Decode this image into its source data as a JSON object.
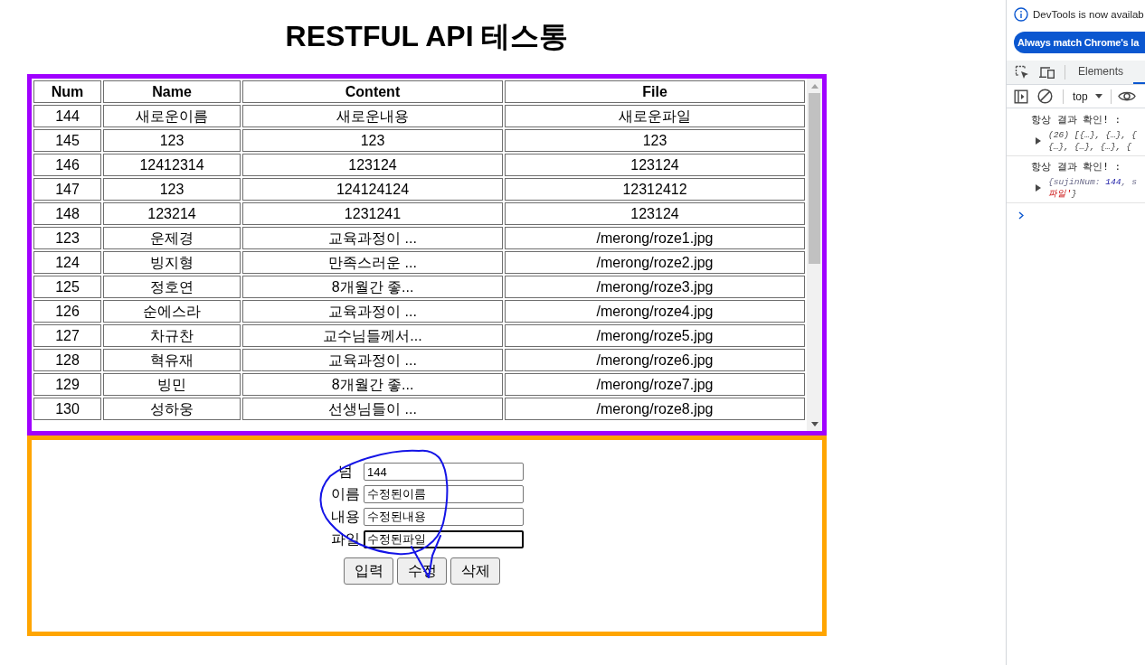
{
  "page": {
    "title": "RESTFUL API 테스통"
  },
  "table": {
    "columns": [
      "Num",
      "Name",
      "Content",
      "File"
    ],
    "rows": [
      [
        "144",
        "새로운이름",
        "새로운내용",
        "새로운파일"
      ],
      [
        "145",
        "123",
        "123",
        "123"
      ],
      [
        "146",
        "12412314",
        "123124",
        "123124"
      ],
      [
        "147",
        "123",
        "124124124",
        "12312412"
      ],
      [
        "148",
        "123214",
        "1231241",
        "123124"
      ],
      [
        "123",
        "운제경",
        "교육과정이 ...",
        "/merong/roze1.jpg"
      ],
      [
        "124",
        "빙지형",
        "만족스러운 ...",
        "/merong/roze2.jpg"
      ],
      [
        "125",
        "정호연",
        "8개월간 좋...",
        "/merong/roze3.jpg"
      ],
      [
        "126",
        "순에스라",
        "교육과정이 ...",
        "/merong/roze4.jpg"
      ],
      [
        "127",
        "차규찬",
        "교수님들께서...",
        "/merong/roze5.jpg"
      ],
      [
        "128",
        "혁유재",
        "교육과정이 ...",
        "/merong/roze6.jpg"
      ],
      [
        "129",
        "빙민",
        "8개월간 좋...",
        "/merong/roze7.jpg"
      ],
      [
        "130",
        "성하웅",
        "선생님들이 ...",
        "/merong/roze8.jpg"
      ]
    ]
  },
  "form": {
    "fields": [
      {
        "label": "넘",
        "value": "144",
        "focused": false
      },
      {
        "label": "이름",
        "value": "수정된이름",
        "focused": false
      },
      {
        "label": "내용",
        "value": "수정된내용",
        "focused": false
      },
      {
        "label": "파일",
        "value": "수정된파일",
        "focused": true
      }
    ],
    "buttons": [
      "입력",
      "수정",
      "삭제"
    ]
  },
  "devtools": {
    "notice": "DevTools is now availab",
    "notice_button": "Always match Chrome's la",
    "tabs": [
      {
        "label": "Elements",
        "selected": false
      },
      {
        "selected": true
      }
    ],
    "context": "top",
    "messages": [
      {
        "text": "항상 결과 확인! :",
        "expanded": false,
        "preview": [
          [
            {
              "text": "(26) [{…}, {…}, {",
              "kind": "plain"
            }
          ],
          [
            {
              "text": "{…}, {…}, {…}, {",
              "kind": "plain"
            }
          ]
        ]
      },
      {
        "text": "항상 결과 확인! :",
        "expanded": false,
        "preview": [
          [
            {
              "text": "{sujinNum: ",
              "kind": "key"
            },
            {
              "text": "144",
              "kind": "number"
            },
            {
              "text": ", s",
              "kind": "key"
            }
          ],
          [
            {
              "text": "파일'",
              "kind": "string"
            },
            {
              "text": "}",
              "kind": "plain"
            }
          ]
        ]
      }
    ]
  }
}
